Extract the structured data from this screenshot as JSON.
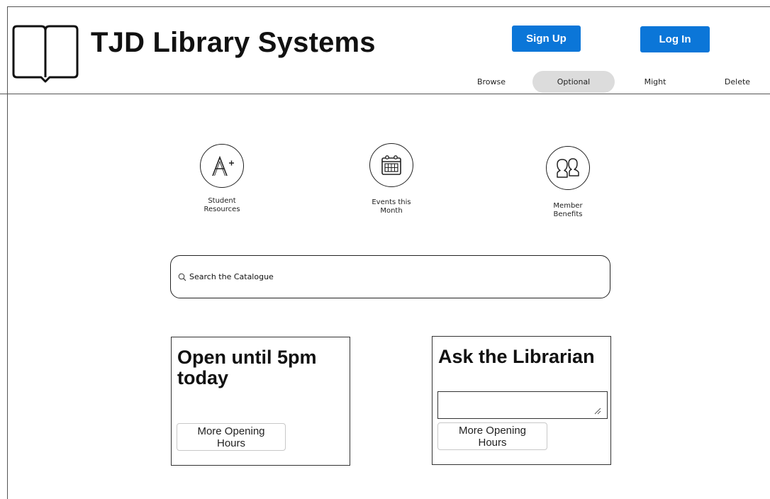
{
  "header": {
    "title": "TJD Library Systems",
    "logo_icon": "open-book-icon",
    "signup_label": "Sign Up",
    "login_label": "Log In",
    "accent_color": "#0b76d8"
  },
  "nav": {
    "items": [
      {
        "label": "Browse"
      },
      {
        "label": "Optional",
        "selected": true
      },
      {
        "label": "Might"
      },
      {
        "label": "Delete"
      }
    ]
  },
  "quick_links": [
    {
      "label": "Student\nResources",
      "icon": "a-plus-icon"
    },
    {
      "label": "Events this\nMonth",
      "icon": "calendar-icon"
    },
    {
      "label": "Member\nBenefits",
      "icon": "users-icon"
    }
  ],
  "search": {
    "placeholder": "Search the Catalogue",
    "icon": "search-icon"
  },
  "cards": {
    "hours": {
      "heading": "Open until 5pm today",
      "button_label": "More Opening Hours"
    },
    "ask": {
      "heading": "Ask the Librarian",
      "textarea_value": "",
      "button_label": "More Opening Hours"
    }
  }
}
